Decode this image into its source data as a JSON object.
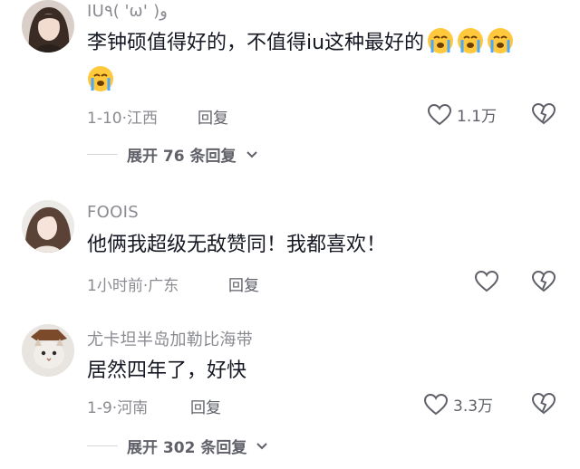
{
  "comments": [
    {
      "username": "IU٩( 'ω' )و",
      "text": "李钟硕值得好的，不值得iu这种最好的",
      "emoji_icon": "crying-face-icon",
      "date": "1-10",
      "location": "江西",
      "reply_label": "回复",
      "likes": "1.1万",
      "expand_label": "展开 76 条回复"
    },
    {
      "username": "FOOIS",
      "text": "他俩我超级无敌赞同！我都喜欢！",
      "date": "1小时前",
      "location": "广东",
      "reply_label": "回复",
      "likes": ""
    },
    {
      "username": "尤卡坦半岛加勒比海带",
      "text": "居然四年了，好快",
      "date": "1-9",
      "location": "河南",
      "reply_label": "回复",
      "likes": "3.3万",
      "expand_label": "展开 302 条回复"
    }
  ],
  "separator": "·",
  "icons": {
    "like": "heart-outline-icon",
    "dislike": "broken-heart-outline-icon",
    "expand": "chevron-down-icon"
  },
  "colors": {
    "text": "#161823",
    "secondary": "#8a8b91",
    "action": "#5f6068"
  }
}
